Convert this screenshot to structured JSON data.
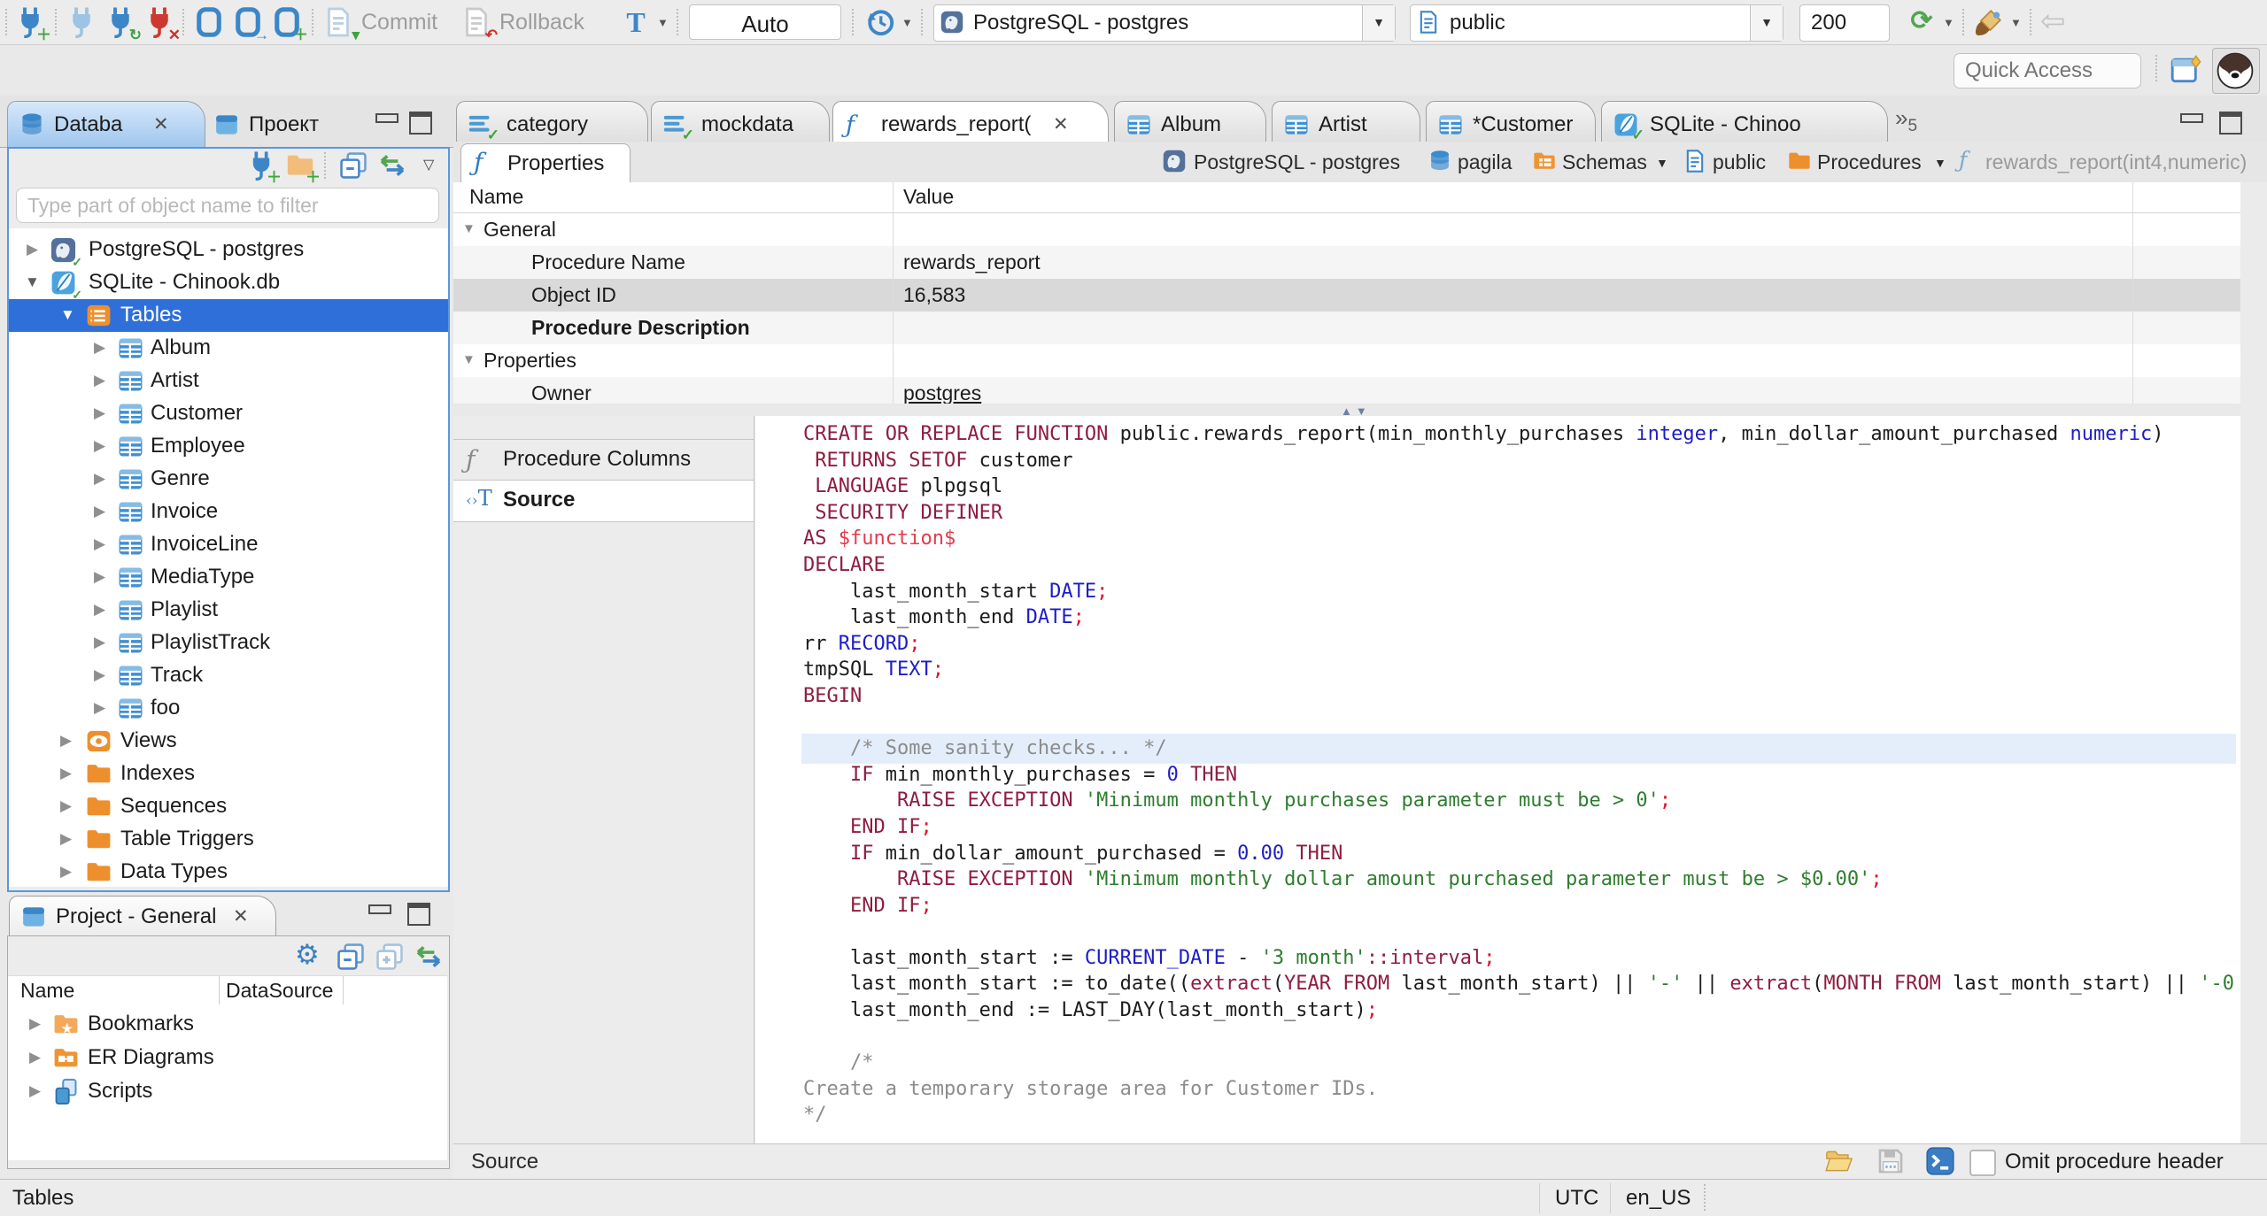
{
  "toolbar": {
    "commit_label": "Commit",
    "rollback_label": "Rollback",
    "tx_mode": "Auto",
    "connection": "PostgreSQL - postgres",
    "schema": "public",
    "fetch_size": "200",
    "quick_access_placeholder": "Quick Access"
  },
  "left_tabs": {
    "database": "Databa",
    "project": "Проект"
  },
  "editor_tabs": [
    {
      "label": "category"
    },
    {
      "label": "mockdata"
    },
    {
      "label": "rewards_report("
    },
    {
      "label": "Album"
    },
    {
      "label": "Artist"
    },
    {
      "label": "*Customer"
    },
    {
      "label": "SQLite - Chinoo"
    }
  ],
  "editor_tabs_overflow_count": "5",
  "navigator": {
    "filter_placeholder": "Type part of object name to filter",
    "tree": [
      {
        "label": "PostgreSQL - postgres"
      },
      {
        "label": "SQLite - Chinook.db"
      },
      {
        "label": "Tables"
      },
      {
        "label": "Album"
      },
      {
        "label": "Artist"
      },
      {
        "label": "Customer"
      },
      {
        "label": "Employee"
      },
      {
        "label": "Genre"
      },
      {
        "label": "Invoice"
      },
      {
        "label": "InvoiceLine"
      },
      {
        "label": "MediaType"
      },
      {
        "label": "Playlist"
      },
      {
        "label": "PlaylistTrack"
      },
      {
        "label": "Track"
      },
      {
        "label": "foo"
      },
      {
        "label": "Views"
      },
      {
        "label": "Indexes"
      },
      {
        "label": "Sequences"
      },
      {
        "label": "Table Triggers"
      },
      {
        "label": "Data Types"
      }
    ]
  },
  "project_panel": {
    "title": "Project - General",
    "columns": {
      "name": "Name",
      "datasource": "DataSource"
    },
    "items": [
      {
        "label": "Bookmarks"
      },
      {
        "label": "ER Diagrams"
      },
      {
        "label": "Scripts"
      }
    ]
  },
  "properties_view": {
    "tab_label": "Properties",
    "header": {
      "name": "Name",
      "value": "Value"
    },
    "rows": [
      {
        "name": "General",
        "value": ""
      },
      {
        "name": "Procedure Name",
        "value": "rewards_report"
      },
      {
        "name": "Object ID",
        "value": "16,583"
      },
      {
        "name": "Procedure Description",
        "value": ""
      },
      {
        "name": "Properties",
        "value": ""
      },
      {
        "name": "Owner",
        "value": "postgres"
      }
    ]
  },
  "breadcrumb": [
    {
      "label": "PostgreSQL - postgres"
    },
    {
      "label": "pagila"
    },
    {
      "label": "Schemas"
    },
    {
      "label": "public"
    },
    {
      "label": "Procedures"
    },
    {
      "label": "rewards_report(int4,numeric)"
    }
  ],
  "subtabs": {
    "procedure_columns": "Procedure Columns",
    "source": "Source"
  },
  "source": {
    "highlight_line": 12,
    "lines": [
      [
        [
          "k",
          "CREATE OR REPLACE FUNCTION "
        ],
        [
          "n",
          "public.rewards_report(min_monthly_purchases "
        ],
        [
          "t",
          "integer"
        ],
        [
          "n",
          ", min_dollar_amount_purchased "
        ],
        [
          "t",
          "numeric"
        ],
        [
          "n",
          ")"
        ]
      ],
      [
        [
          "n",
          " "
        ],
        [
          "k",
          "RETURNS SETOF"
        ],
        [
          "n",
          " customer"
        ]
      ],
      [
        [
          "n",
          " "
        ],
        [
          "k",
          "LANGUAGE"
        ],
        [
          "n",
          " plpgsql"
        ]
      ],
      [
        [
          "n",
          " "
        ],
        [
          "k",
          "SECURITY DEFINER"
        ]
      ],
      [
        [
          "k",
          "AS"
        ],
        [
          "n",
          " "
        ],
        [
          "d",
          "$function$"
        ]
      ],
      [
        [
          "k",
          "DECLARE"
        ]
      ],
      [
        [
          "n",
          "    last_month_start "
        ],
        [
          "t",
          "DATE"
        ],
        [
          "p",
          ";"
        ]
      ],
      [
        [
          "n",
          "    last_month_end "
        ],
        [
          "t",
          "DATE"
        ],
        [
          "p",
          ";"
        ]
      ],
      [
        [
          "n",
          "rr "
        ],
        [
          "t",
          "RECORD"
        ],
        [
          "p",
          ";"
        ]
      ],
      [
        [
          "n",
          "tmpSQL "
        ],
        [
          "t",
          "TEXT"
        ],
        [
          "p",
          ";"
        ]
      ],
      [
        [
          "k",
          "BEGIN"
        ]
      ],
      [],
      [
        [
          "c",
          "    /* Some sanity checks... */"
        ]
      ],
      [
        [
          "n",
          "    "
        ],
        [
          "k",
          "IF"
        ],
        [
          "n",
          " min_monthly_purchases = "
        ],
        [
          "t",
          "0"
        ],
        [
          "n",
          " "
        ],
        [
          "k",
          "THEN"
        ]
      ],
      [
        [
          "n",
          "        "
        ],
        [
          "k",
          "RAISE EXCEPTION"
        ],
        [
          "n",
          " "
        ],
        [
          "s",
          "'Minimum monthly purchases parameter must be > 0'"
        ],
        [
          "p",
          ";"
        ]
      ],
      [
        [
          "n",
          "    "
        ],
        [
          "k",
          "END IF"
        ],
        [
          "p",
          ";"
        ]
      ],
      [
        [
          "n",
          "    "
        ],
        [
          "k",
          "IF"
        ],
        [
          "n",
          " min_dollar_amount_purchased = "
        ],
        [
          "t",
          "0.00"
        ],
        [
          "n",
          " "
        ],
        [
          "k",
          "THEN"
        ]
      ],
      [
        [
          "n",
          "        "
        ],
        [
          "k",
          "RAISE EXCEPTION"
        ],
        [
          "n",
          " "
        ],
        [
          "s",
          "'Minimum monthly dollar amount purchased parameter must be > $0.00'"
        ],
        [
          "p",
          ";"
        ]
      ],
      [
        [
          "n",
          "    "
        ],
        [
          "k",
          "END IF"
        ],
        [
          "p",
          ";"
        ]
      ],
      [],
      [
        [
          "n",
          "    last_month_start := "
        ],
        [
          "t",
          "CURRENT_DATE"
        ],
        [
          "n",
          " - "
        ],
        [
          "s",
          "'3 month'"
        ],
        [
          "k",
          "::interval"
        ],
        [
          "p",
          ";"
        ]
      ],
      [
        [
          "n",
          "    last_month_start := to_date(("
        ],
        [
          "k",
          "extract"
        ],
        [
          "n",
          "("
        ],
        [
          "k",
          "YEAR FROM"
        ],
        [
          "n",
          " last_month_start) || "
        ],
        [
          "s",
          "'-'"
        ],
        [
          "n",
          " || "
        ],
        [
          "k",
          "extract"
        ],
        [
          "n",
          "("
        ],
        [
          "k",
          "MONTH FROM"
        ],
        [
          "n",
          " last_month_start) || "
        ],
        [
          "s",
          "'-0"
        ]
      ],
      [
        [
          "n",
          "    last_month_end := LAST_DAY(last_month_start)"
        ],
        [
          "p",
          ";"
        ]
      ],
      [],
      [
        [
          "c",
          "    /*"
        ]
      ],
      [
        [
          "c",
          "Create a temporary storage area for Customer IDs."
        ]
      ],
      [
        [
          "c",
          "*/"
        ]
      ]
    ]
  },
  "editor_footer": {
    "page_label": "Source",
    "omit_label": "Omit procedure header"
  },
  "statusbar": {
    "left": "Tables",
    "timezone": "UTC",
    "locale": "en_US"
  },
  "colors": {
    "accent": "#2f6fd9",
    "keyword": "#8e1d40",
    "string": "#2e7d2e",
    "type": "#1d1dc8",
    "link": "#1766d8",
    "selection_gray": "#d9d9d9"
  }
}
